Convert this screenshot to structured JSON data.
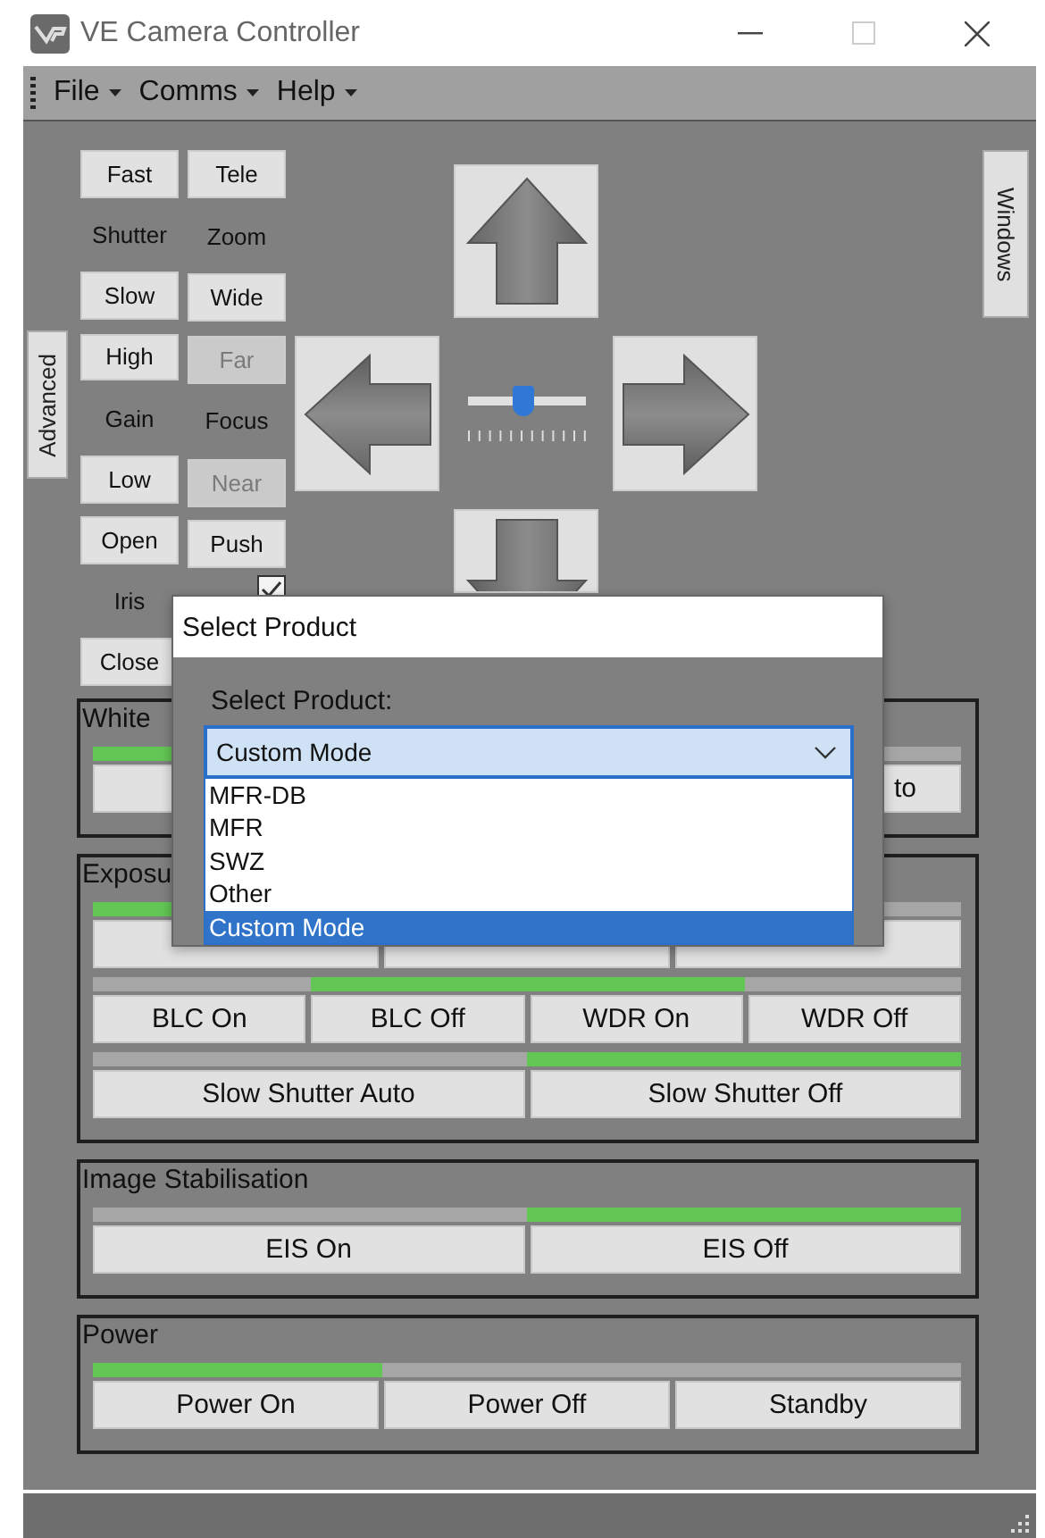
{
  "window": {
    "title": "VE Camera Controller"
  },
  "menu": [
    {
      "label": "File"
    },
    {
      "label": "Comms"
    },
    {
      "label": "Help"
    }
  ],
  "side_tabs": {
    "left": "Advanced",
    "right": "Windows"
  },
  "controls": {
    "left": [
      {
        "kind": "button",
        "label": "Fast",
        "disabled": false
      },
      {
        "kind": "label",
        "label": "Shutter"
      },
      {
        "kind": "button",
        "label": "Slow",
        "disabled": false
      },
      {
        "kind": "button",
        "label": "High",
        "disabled": false
      },
      {
        "kind": "label",
        "label": "Gain"
      },
      {
        "kind": "button",
        "label": "Low",
        "disabled": false
      },
      {
        "kind": "button",
        "label": "Open",
        "disabled": false
      },
      {
        "kind": "label",
        "label": "Iris"
      },
      {
        "kind": "button",
        "label": "Close",
        "disabled": false
      }
    ],
    "right": [
      {
        "kind": "button",
        "label": "Tele",
        "disabled": false
      },
      {
        "kind": "label",
        "label": "Zoom"
      },
      {
        "kind": "button",
        "label": "Wide",
        "disabled": false
      },
      {
        "kind": "button",
        "label": "Far",
        "disabled": true
      },
      {
        "kind": "label",
        "label": "Focus"
      },
      {
        "kind": "button",
        "label": "Near",
        "disabled": true
      },
      {
        "kind": "button",
        "label": "Push",
        "disabled": false
      },
      {
        "kind": "checkbox",
        "checked": true
      }
    ]
  },
  "speed_slider": {
    "level": 0.48
  },
  "groups": [
    {
      "title": "White",
      "rows": [
        {
          "buttons": [
            {
              "kind": "shown",
              "selected": true
            },
            {
              "kind": "covered"
            },
            {
              "kind": "shown",
              "label": "to",
              "selected": false
            }
          ]
        }
      ]
    },
    {
      "title": "Exposu",
      "rows": [
        {
          "buttons": [
            {
              "kind": "shown",
              "selected": true
            },
            {
              "kind": "partly_covered"
            },
            {
              "kind": "shown",
              "selected": false
            }
          ]
        },
        {
          "buttons": [
            {
              "label": "BLC On",
              "selected": false
            },
            {
              "label": "BLC Off",
              "selected": true
            },
            {
              "label": "WDR On",
              "selected": true
            },
            {
              "label": "WDR Off",
              "selected": false
            }
          ]
        },
        {
          "buttons": [
            {
              "label": "Slow Shutter Auto",
              "selected": false
            },
            {
              "label": "Slow Shutter Off",
              "selected": true
            }
          ]
        }
      ]
    },
    {
      "title": "Image Stabilisation",
      "rows": [
        {
          "buttons": [
            {
              "label": "EIS On",
              "selected": false
            },
            {
              "label": "EIS Off",
              "selected": true
            }
          ]
        }
      ]
    },
    {
      "title": "Power",
      "rows": [
        {
          "buttons": [
            {
              "label": "Power On",
              "selected": true
            },
            {
              "label": "Power Off",
              "selected": false
            },
            {
              "label": "Standby",
              "selected": false
            }
          ]
        }
      ]
    }
  ],
  "dialog": {
    "title": "Select Product",
    "prompt": "Select Product:",
    "value": "Custom Mode",
    "options": [
      {
        "label": "MFR-DB",
        "selected": false
      },
      {
        "label": "MFR",
        "selected": false
      },
      {
        "label": "SWZ",
        "selected": false
      },
      {
        "label": "Other",
        "selected": false
      },
      {
        "label": "Custom Mode",
        "selected": true
      }
    ]
  }
}
